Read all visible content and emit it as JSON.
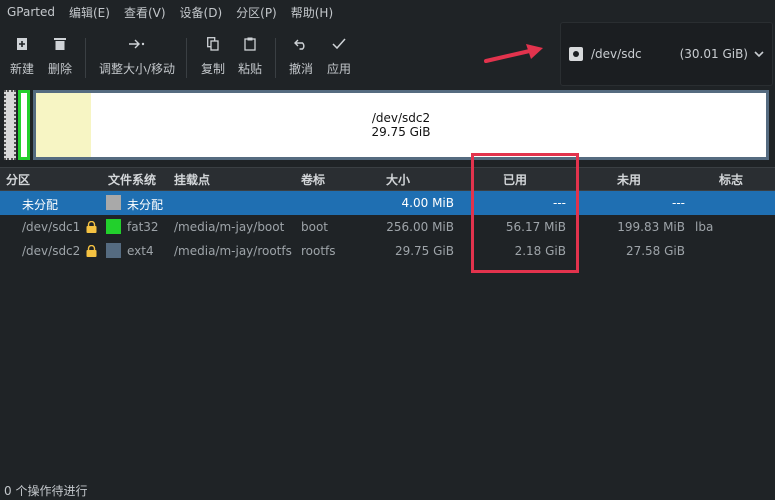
{
  "menubar": {
    "items": [
      "GParted",
      "编辑(E)",
      "查看(V)",
      "设备(D)",
      "分区(P)",
      "帮助(H)"
    ]
  },
  "toolbar": {
    "new": "新建",
    "delete": "删除",
    "resize_move": "调整大小/移动",
    "copy": "复制",
    "paste": "粘贴",
    "undo": "撤消",
    "apply": "应用"
  },
  "device": {
    "name": "/dev/sdc",
    "size": "(30.01 GiB)"
  },
  "diskmap": {
    "partition_name": "/dev/sdc2",
    "partition_size": "29.75 GiB"
  },
  "table": {
    "headers": {
      "partition": "分区",
      "filesystem": "文件系统",
      "mountpoint": "挂载点",
      "label": "卷标",
      "size": "大小",
      "used": "已用",
      "unused": "未用",
      "flags": "标志"
    },
    "rows": [
      {
        "partition": "未分配",
        "fs_color": "#a9a9a9",
        "filesystem": "未分配",
        "mountpoint": "",
        "label": "",
        "size": "4.00 MiB",
        "used": "---",
        "unused": "---",
        "flags": "",
        "locked": false
      },
      {
        "partition": "/dev/sdc1",
        "fs_color": "#22d02c",
        "filesystem": "fat32",
        "mountpoint": "/media/m-jay/boot",
        "label": "boot",
        "size": "256.00 MiB",
        "used": "56.17 MiB",
        "unused": "199.83 MiB",
        "flags": "lba",
        "locked": true
      },
      {
        "partition": "/dev/sdc2",
        "fs_color": "#556b80",
        "filesystem": "ext4",
        "mountpoint": "/media/m-jay/rootfs",
        "label": "rootfs",
        "size": "29.75 GiB",
        "used": "2.18 GiB",
        "unused": "27.58 GiB",
        "flags": "",
        "locked": true
      }
    ]
  },
  "statusbar": {
    "text": "0 个操作待进行"
  },
  "colors": {
    "selection": "#1f6fb2",
    "highlight_box": "#e2334d",
    "fat32": "#22d02c",
    "ext4": "#556b80",
    "used_space": "#f7f5c4"
  }
}
